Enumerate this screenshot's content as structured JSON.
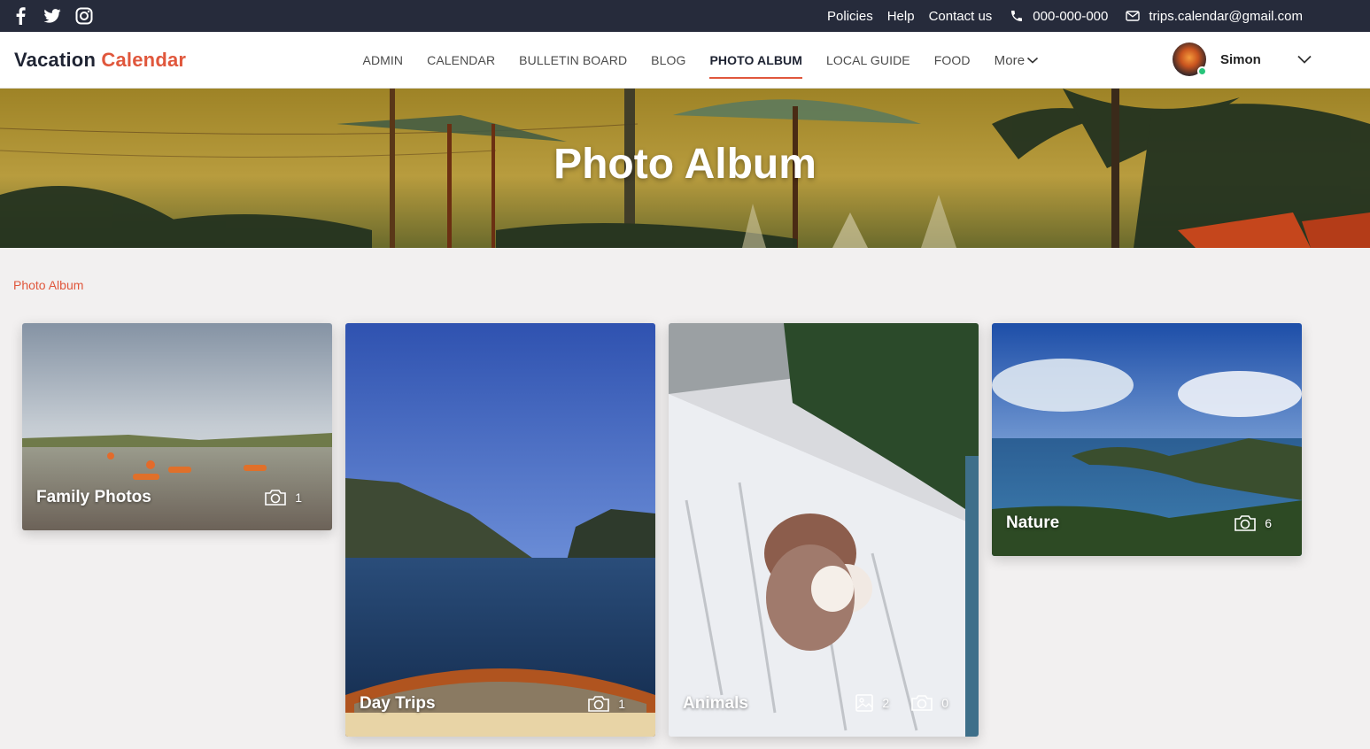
{
  "topbar": {
    "social": [
      "facebook-icon",
      "twitter-icon",
      "instagram-icon"
    ],
    "links": [
      "Policies",
      "Help",
      "Contact us"
    ],
    "phone": "000-000-000",
    "email": "trips.calendar@gmail.com"
  },
  "brand": {
    "part1": "Vacation",
    "part2": "Calendar",
    "accent": "#e0573c"
  },
  "nav": {
    "items": [
      {
        "label": "ADMIN"
      },
      {
        "label": "CALENDAR"
      },
      {
        "label": "BULLETIN BOARD"
      },
      {
        "label": "BLOG"
      },
      {
        "label": "PHOTO ALBUM",
        "active": true
      },
      {
        "label": "LOCAL GUIDE"
      },
      {
        "label": "FOOD"
      }
    ],
    "more_label": "More"
  },
  "user": {
    "name": "Simon",
    "status_color": "#27c47a"
  },
  "hero": {
    "title": "Photo Album"
  },
  "breadcrumb": "Photo Album",
  "albums": [
    {
      "title": "Family Photos",
      "photo_count": "1"
    },
    {
      "title": "Day Trips",
      "photo_count": "1"
    },
    {
      "title": "Animals",
      "image_count": "2",
      "photo_count": "0"
    },
    {
      "title": "Nature",
      "photo_count": "6"
    }
  ],
  "colors": {
    "topbar": "#262b3b",
    "accent": "#e0573c",
    "page_bg": "#f2f0f0"
  }
}
